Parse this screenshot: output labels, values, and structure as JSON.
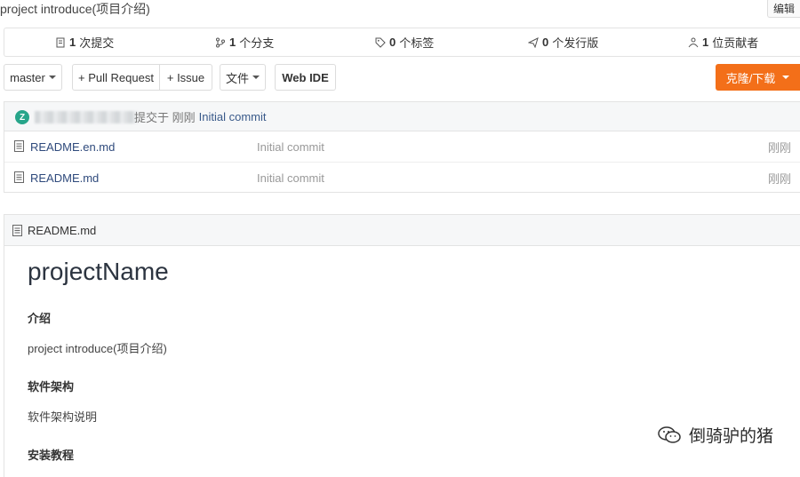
{
  "project": {
    "description": "project introduce(项目介绍)",
    "edit_label": "编辑"
  },
  "stats": [
    {
      "icon": "commit-icon",
      "count": "1",
      "label": "次提交"
    },
    {
      "icon": "branch-icon",
      "count": "1",
      "label": "个分支"
    },
    {
      "icon": "tag-icon",
      "count": "0",
      "label": "个标签"
    },
    {
      "icon": "release-icon",
      "count": "0",
      "label": "个发行版"
    },
    {
      "icon": "contributors-icon",
      "count": "1",
      "label": "位贡献者"
    }
  ],
  "toolbar": {
    "branch": "master",
    "pull_request": "+ Pull Request",
    "issue": "+ Issue",
    "files": "文件",
    "web_ide": "Web IDE",
    "clone": "克隆/下载"
  },
  "last_commit": {
    "avatar_letter": "Z",
    "submitted_text": "提交于 刚刚",
    "message": "Initial commit"
  },
  "files": [
    {
      "name": "README.en.md",
      "commit": "Initial commit",
      "time": "刚刚"
    },
    {
      "name": "README.md",
      "commit": "Initial commit",
      "time": "刚刚"
    }
  ],
  "readme": {
    "filename": "README.md",
    "h1": "projectName",
    "sections": [
      {
        "heading": "介绍",
        "text": "project introduce(项目介绍)"
      },
      {
        "heading": "软件架构",
        "text": "软件架构说明"
      },
      {
        "heading": "安装教程"
      }
    ]
  },
  "watermark": {
    "text": "倒骑驴的猪"
  },
  "colors": {
    "accent": "#f36f19",
    "link": "#2f4a7c",
    "avatar": "#27a58a"
  }
}
